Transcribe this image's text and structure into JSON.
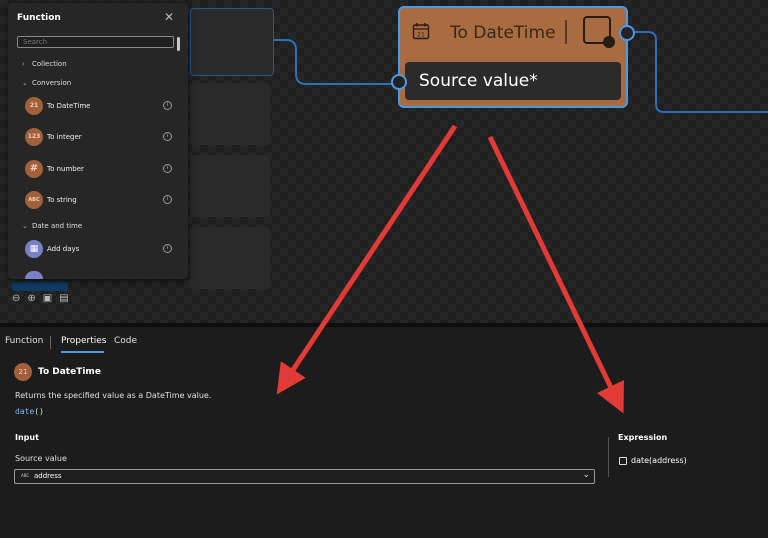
{
  "function_panel": {
    "title": "Function",
    "search_placeholder": "Search",
    "categories": [
      {
        "label": "Collection",
        "expanded": false
      },
      {
        "label": "Conversion",
        "expanded": true
      },
      {
        "label": "Date and time",
        "expanded": true
      }
    ],
    "conversion_items": [
      {
        "label": "To DateTime",
        "icon": "calendar-icon",
        "glyph": "21"
      },
      {
        "label": "To integer",
        "icon": "integer-icon",
        "glyph": "123"
      },
      {
        "label": "To number",
        "icon": "hash-icon",
        "glyph": "#"
      },
      {
        "label": "To string",
        "icon": "string-icon",
        "glyph": "ABC"
      }
    ],
    "datetime_items": [
      {
        "label": "Add days",
        "icon": "calendar-add-icon",
        "glyph": "▦"
      }
    ],
    "info_glyph": "i"
  },
  "node": {
    "title": "To DateTime",
    "input_label": "Source value*",
    "calendar_glyph": "21"
  },
  "bottom_panel": {
    "tabs": [
      {
        "label": "Function",
        "active": false
      },
      {
        "label": "Properties",
        "active": true
      },
      {
        "label": "Code",
        "active": false
      }
    ],
    "function_title": "To DateTime",
    "function_glyph": "21",
    "description": "Returns the specified value as a DateTime value.",
    "signature_name": "date",
    "signature_parens": "()",
    "input_heading": "Input",
    "source_value_label": "Source value",
    "source_value_type": "ABC",
    "source_value": "address",
    "expression_heading": "Expression",
    "expression_value": "date(address)"
  },
  "colors": {
    "accent": "#4a9ae8",
    "node": "#a86c40",
    "arrow": "#e23a36"
  }
}
